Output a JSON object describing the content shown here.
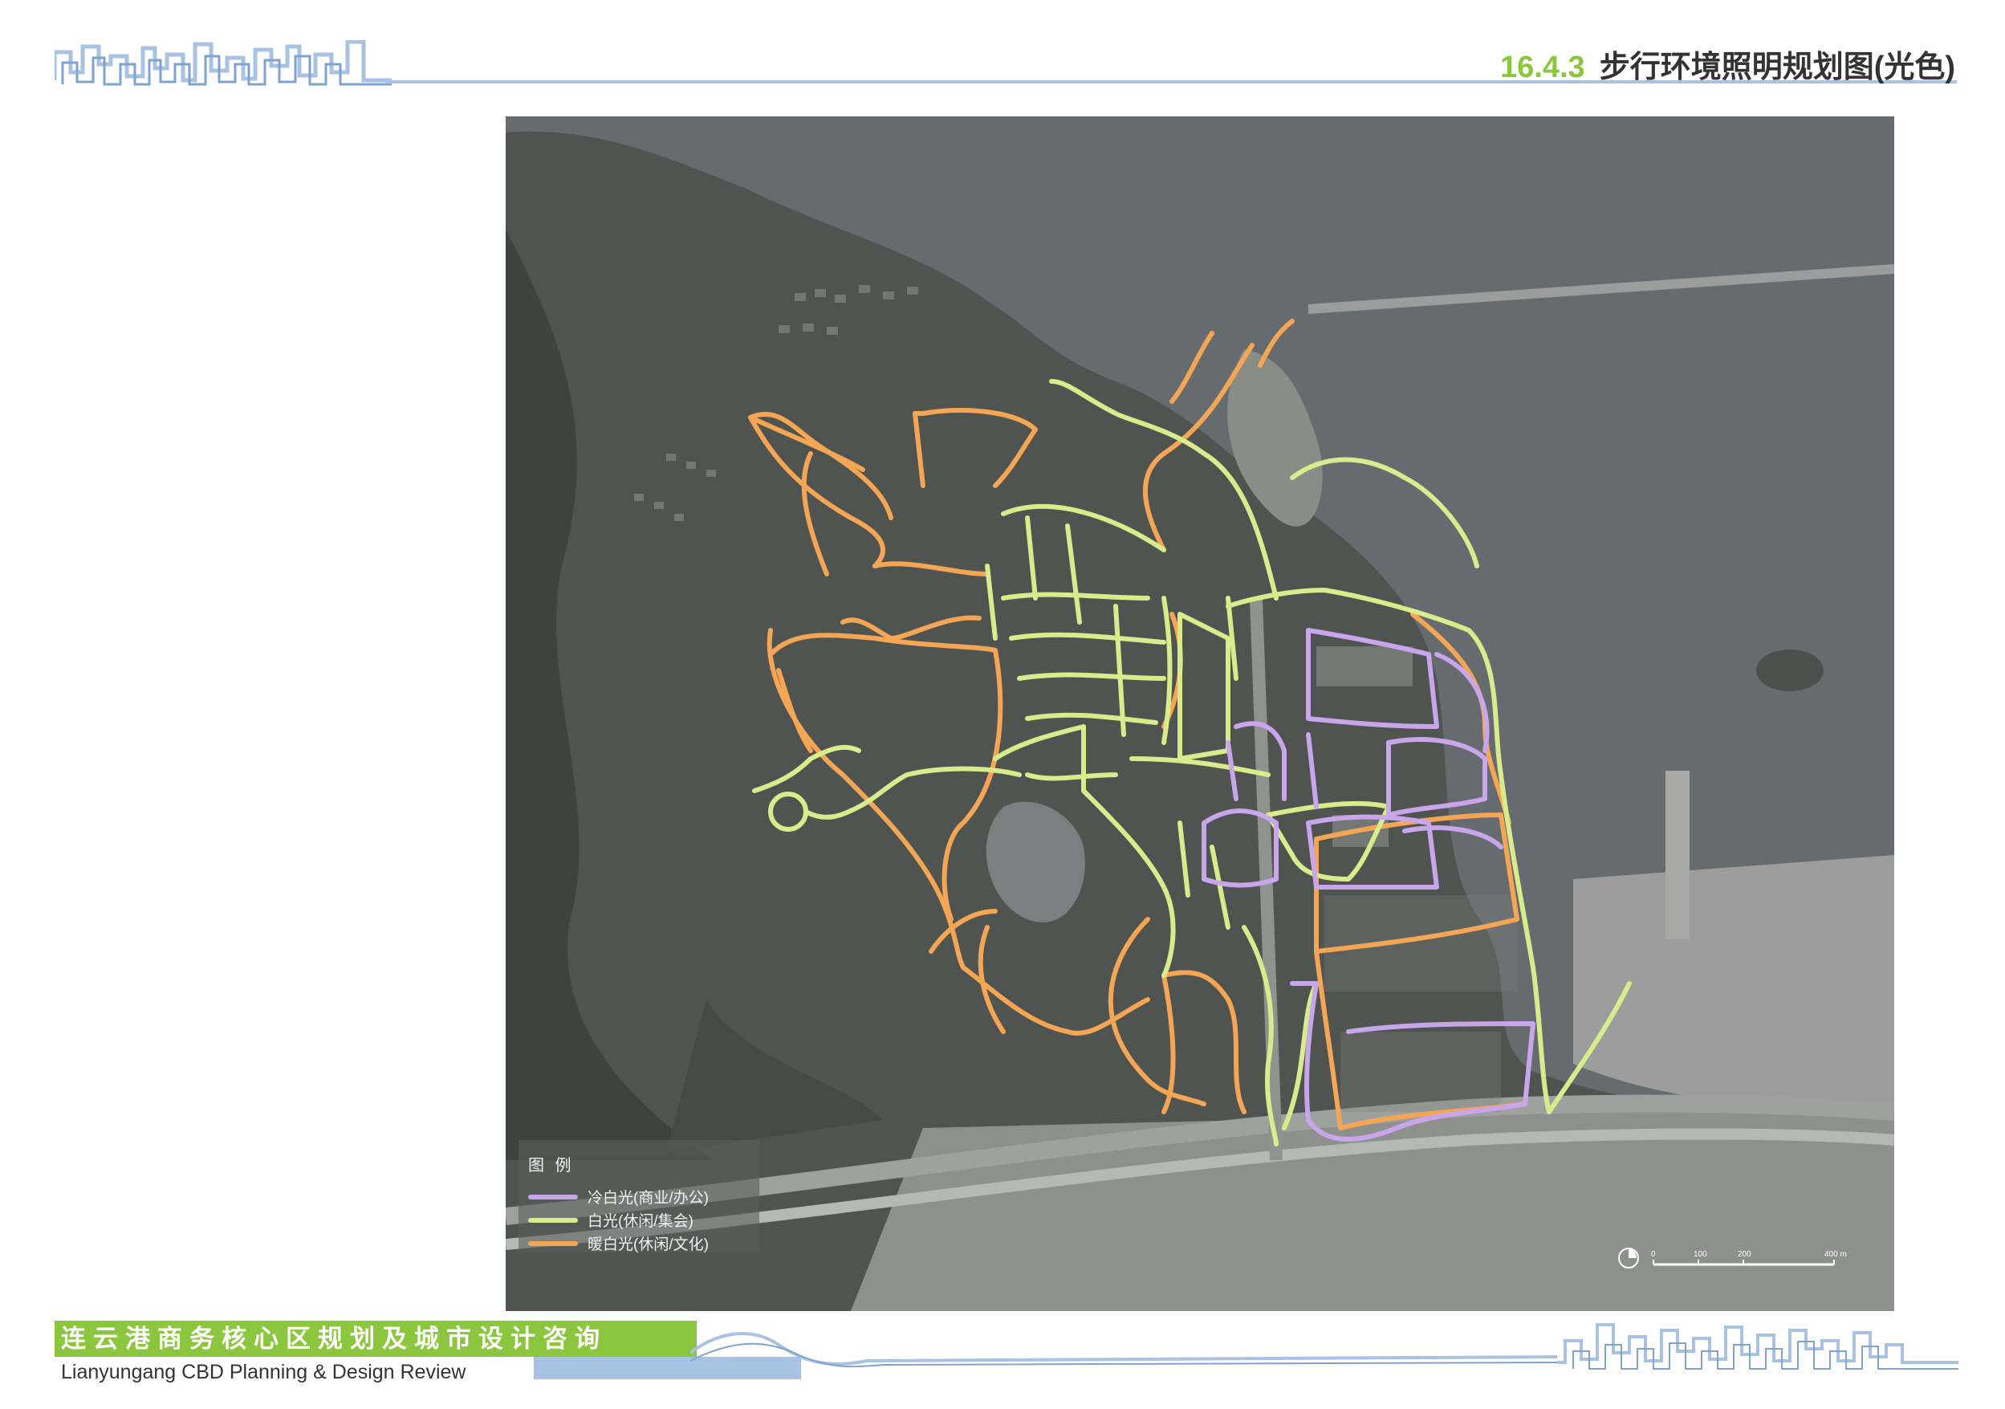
{
  "header": {
    "section_number": "16.4.3",
    "title": "步行环境照明规划图(光色)"
  },
  "legend": {
    "title": "图 例",
    "items": [
      {
        "label": "冷白光(商业/办公)",
        "color": "#c9a6ec"
      },
      {
        "label": "白光(休闲/集会)",
        "color": "#d8ec8c"
      },
      {
        "label": "暖白光(休闲/文化)",
        "color": "#f5a654"
      }
    ]
  },
  "scale": {
    "labels": [
      "0",
      "100",
      "200",
      "400 m"
    ]
  },
  "footer": {
    "title_cn": "连云港商务核心区规划及城市设计咨询",
    "title_en": "Lianyungang CBD Planning & Design Review"
  },
  "colors": {
    "accent_green": "#8cc63f",
    "accent_blue": "#a8c2e2",
    "sea": "#666b70",
    "land": "#4f5450"
  }
}
